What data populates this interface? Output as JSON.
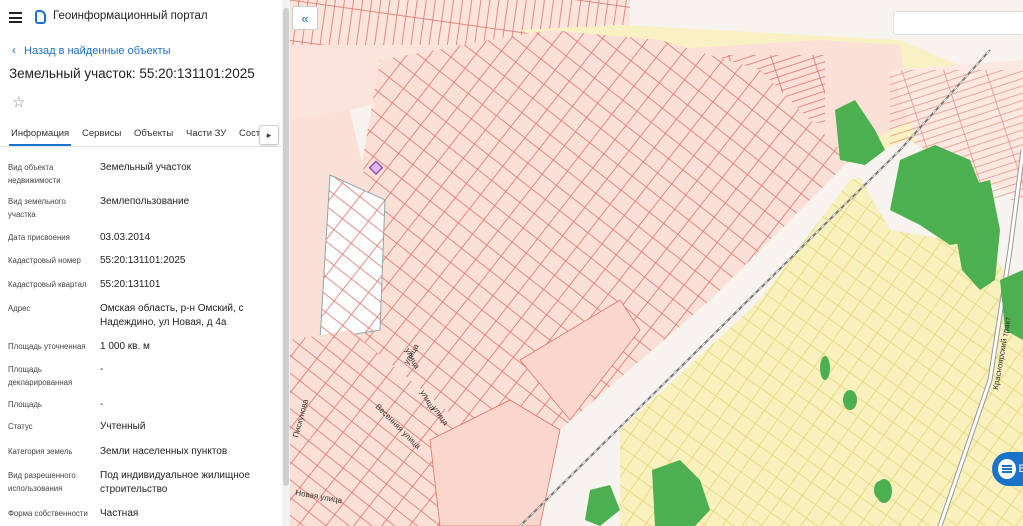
{
  "header": {
    "title": "Геоинформационный портал",
    "menu_icon": "hamburger-menu-icon",
    "logo_icon": "portal-logo-icon"
  },
  "back_link": "Назад в найденные объекты",
  "object_title": "Земельный участок: 55:20:131101:2025",
  "tabs": [
    {
      "label": "Информация",
      "active": true
    },
    {
      "label": "Сервисы"
    },
    {
      "label": "Объекты"
    },
    {
      "label": "Части ЗУ"
    },
    {
      "label": "Соста"
    }
  ],
  "tab_scroll_label": "▸",
  "attributes": [
    {
      "label": "Вид объекта недвижимости",
      "value": "Земельный участок"
    },
    {
      "label": "Вид земельного участка",
      "value": "Землепользование"
    },
    {
      "label": "Дата присвоения",
      "value": "03.03.2014"
    },
    {
      "label": "Кадастровый номер",
      "value": "55:20:131101:2025"
    },
    {
      "label": "Кадастровый квартал",
      "value": "55:20:131101"
    },
    {
      "label": "Адрес",
      "value": "Омская область, р-н Омский, с Надеждино, ул Новая, д 4а"
    },
    {
      "label": "Площадь уточненная",
      "value": "1 000 кв. м"
    },
    {
      "label": "Площадь декларированная",
      "value": "-"
    },
    {
      "label": "Площадь",
      "value": "-"
    },
    {
      "label": "Статус",
      "value": "Учтенный"
    },
    {
      "label": "Категория земель",
      "value": "Земли населенных пунктов"
    },
    {
      "label": "Вид разрешенного использования",
      "value": "Под индивидуальное жилищное строительство"
    },
    {
      "label": "Форма собственности",
      "value": "Частная"
    }
  ],
  "map": {
    "collapse_label": "«",
    "fab_label": "Во",
    "street_labels": [
      "Красноярский тракт",
      "улица",
      "улица",
      "улица",
      "улица",
      "Весенняя улица",
      "Пискунова",
      "Новая улица"
    ],
    "colors": {
      "parcel": "#e0736a",
      "zone_pink": "#fbe0d8",
      "zone_yellow": "#f7f0b8",
      "forest": "#4caf50",
      "accent": "#1a73c8"
    }
  }
}
